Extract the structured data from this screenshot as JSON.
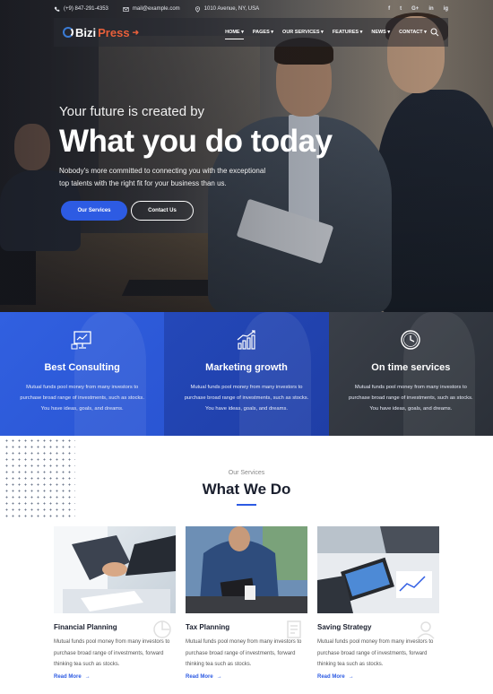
{
  "topbar": {
    "phone": "(+9) 847-291-4353",
    "email": "mail@example.com",
    "address": "1010 Avenue, NY, USA",
    "social": [
      "f",
      "t",
      "G+",
      "in",
      "ig"
    ]
  },
  "nav": {
    "logo_main": "Bizi",
    "logo_accent": "Press",
    "items": [
      "HOME",
      "PAGES",
      "OUR SERVICES",
      "FEATURES",
      "NEWS",
      "CONTACT"
    ]
  },
  "hero": {
    "pretitle": "Your future is created by",
    "title": "What you do today",
    "subtitle": "Nobody's more committed to connecting you with the exceptional top talents with the right fit for your business than us.",
    "btn_primary": "Our Services",
    "btn_secondary": "Contact Us"
  },
  "features": [
    {
      "icon": "presentation-chart-icon",
      "title": "Best Consulting",
      "text": "Mutual funds pool money from many investors to purchase broad range of investments, such as stocks. You have ideas, goals, and dreams."
    },
    {
      "icon": "growth-chart-icon",
      "title": "Marketing growth",
      "text": "Mutual funds pool money from many investors to purchase broad range of investments, such as stocks. You have ideas, goals, and dreams."
    },
    {
      "icon": "clock-icon",
      "title": "On time services",
      "text": "Mutual funds pool money from many investors to purchase broad range of investments, such as stocks. You have ideas, goals, and dreams."
    }
  ],
  "services": {
    "subtitle": "Our Services",
    "title": "What We Do",
    "cards": [
      {
        "title": "Financial Planning",
        "text": "Mutual funds pool money from many investors to purchase broad range of investments, forward thinking tea such as stocks.",
        "link": "Read More"
      },
      {
        "title": "Tax Planning",
        "text": "Mutual funds pool money from many investors to purchase broad range of investments, forward thinking tea such as stocks.",
        "link": "Read More"
      },
      {
        "title": "Saving Strategy",
        "text": "Mutual funds pool money from many investors to purchase broad range of investments, forward thinking tea such as stocks.",
        "link": "Read More"
      }
    ]
  },
  "colors": {
    "accent": "#2d5be3",
    "brand_orange": "#e9603b",
    "dark": "#1a1f2e"
  }
}
